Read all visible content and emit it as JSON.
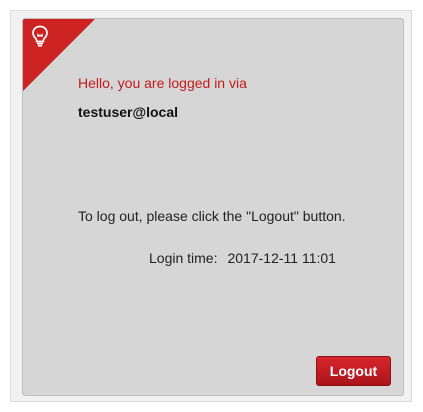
{
  "login_panel": {
    "greeting": "Hello, you are logged in via",
    "username": "testuser@local",
    "logout_hint": "To log out, please click the \"Logout\" button.",
    "login_time_label": "Login time:",
    "login_time_value": "2017-12-11 11:01",
    "logout_button_label": "Logout"
  },
  "icons": {
    "corner_icon": "lightbulb-icon"
  },
  "colors": {
    "accent": "#cc2222",
    "greeting_text": "#c41a1a",
    "panel_background": "#d6d6d6",
    "button_background": "#c01d22"
  }
}
